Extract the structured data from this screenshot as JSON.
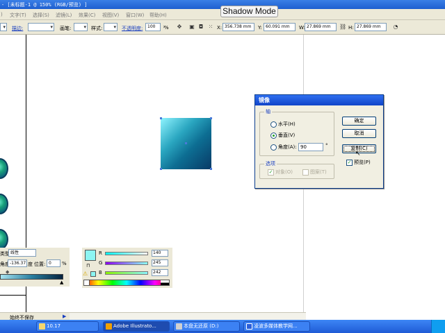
{
  "window": {
    "title": "- [未标题-1 @ 150% (RGB/预览) ]"
  },
  "overlay": {
    "shadow_mode": "Shadow Mode"
  },
  "menubar": {
    "items": [
      "文字(T)",
      "选择(S)",
      "滤镜(L)",
      "效果(C)",
      "视图(V)",
      "窗口(W)",
      "帮助(H)"
    ]
  },
  "controlbar": {
    "stroke_label": "描边:",
    "brush_label": "画笔:",
    "style_label": "样式:",
    "opacity_label": "不透明度:",
    "opacity_value": "100",
    "opacity_unit": "%",
    "x_label": "X:",
    "x_value": "356.738 mm",
    "y_label": "Y:",
    "y_value": "60.091 mm",
    "w_label": "W:",
    "w_value": "27.869 mm",
    "h_label": "H:",
    "h_value": "27.869 mm"
  },
  "dialog": {
    "title": "镜像",
    "axis_group": "轴",
    "horizontal": "水平(H)",
    "vertical": "垂直(V)",
    "angle": "角度(A):",
    "angle_value": "90",
    "angle_unit": "°",
    "selected_axis": "vertical",
    "options_group": "选项",
    "objects": "对象(O)",
    "patterns": "图案(T)",
    "ok": "确定",
    "cancel": "取消",
    "copy": "复制(C)",
    "preview": "预览(P)",
    "preview_checked": true
  },
  "gradient_panel": {
    "type_label": "类型:",
    "type_value": "线性",
    "angle_label": "角度:",
    "angle_value": "-136.37",
    "angle_unit": "度",
    "position_label": "位置:",
    "position_value": "0",
    "position_unit": "%"
  },
  "color_panel": {
    "r_label": "R",
    "r_value": "140",
    "g_label": "G",
    "g_value": "245",
    "b_label": "B",
    "b_value": "242",
    "swatch_color": "#8cf5f2"
  },
  "statusbar": {
    "text": "始终不保存"
  },
  "taskbar": {
    "items": [
      "10.17",
      "Adobe Illustrato...",
      "本盘无还原 (D:)",
      "凌波多媒体教学网..."
    ]
  }
}
